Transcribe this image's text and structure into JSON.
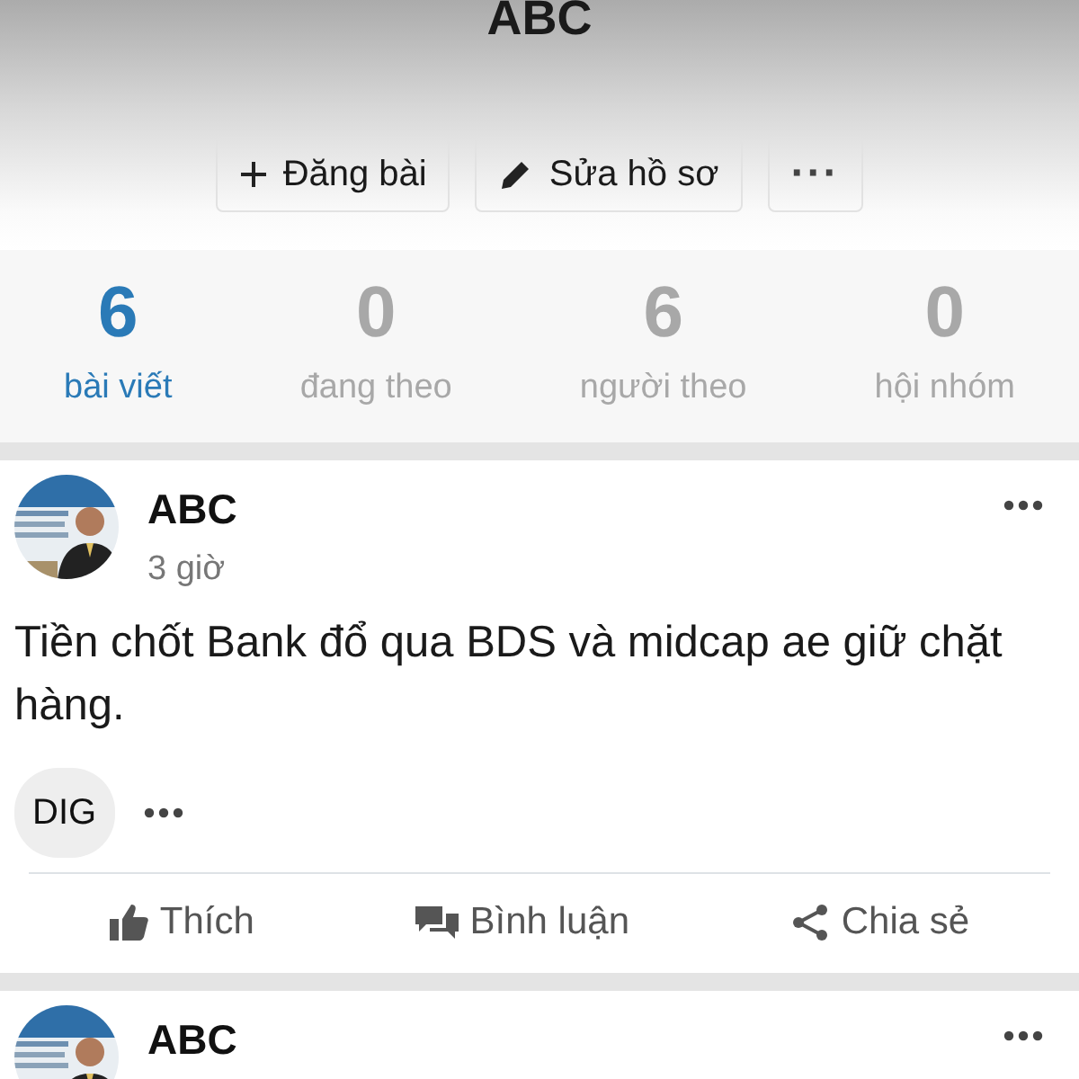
{
  "profile": {
    "title": "ABC",
    "buttons": [
      {
        "kind": "post",
        "label": "Đăng bài"
      },
      {
        "kind": "edit",
        "label": "Sửa hồ sơ"
      },
      {
        "kind": "more",
        "label": "···"
      }
    ]
  },
  "stats": [
    {
      "value": "6",
      "label": "bài viết",
      "selected": true
    },
    {
      "value": "0",
      "label": "đang theo",
      "selected": false
    },
    {
      "value": "6",
      "label": "người theo",
      "selected": false
    },
    {
      "value": "0",
      "label": "hội nhóm",
      "selected": false
    }
  ],
  "posts": [
    {
      "author": "ABC",
      "time": "3 giờ",
      "text": "Tiền chốt Bank đổ qua BDS và midcap ae giữ chặt hàng.",
      "tags": [
        "DIG"
      ],
      "actions": [
        {
          "kind": "like",
          "label": "Thích"
        },
        {
          "kind": "comment",
          "label": "Bình luận"
        },
        {
          "kind": "share",
          "label": "Chia sẻ"
        }
      ]
    },
    {
      "author": "ABC"
    }
  ]
}
